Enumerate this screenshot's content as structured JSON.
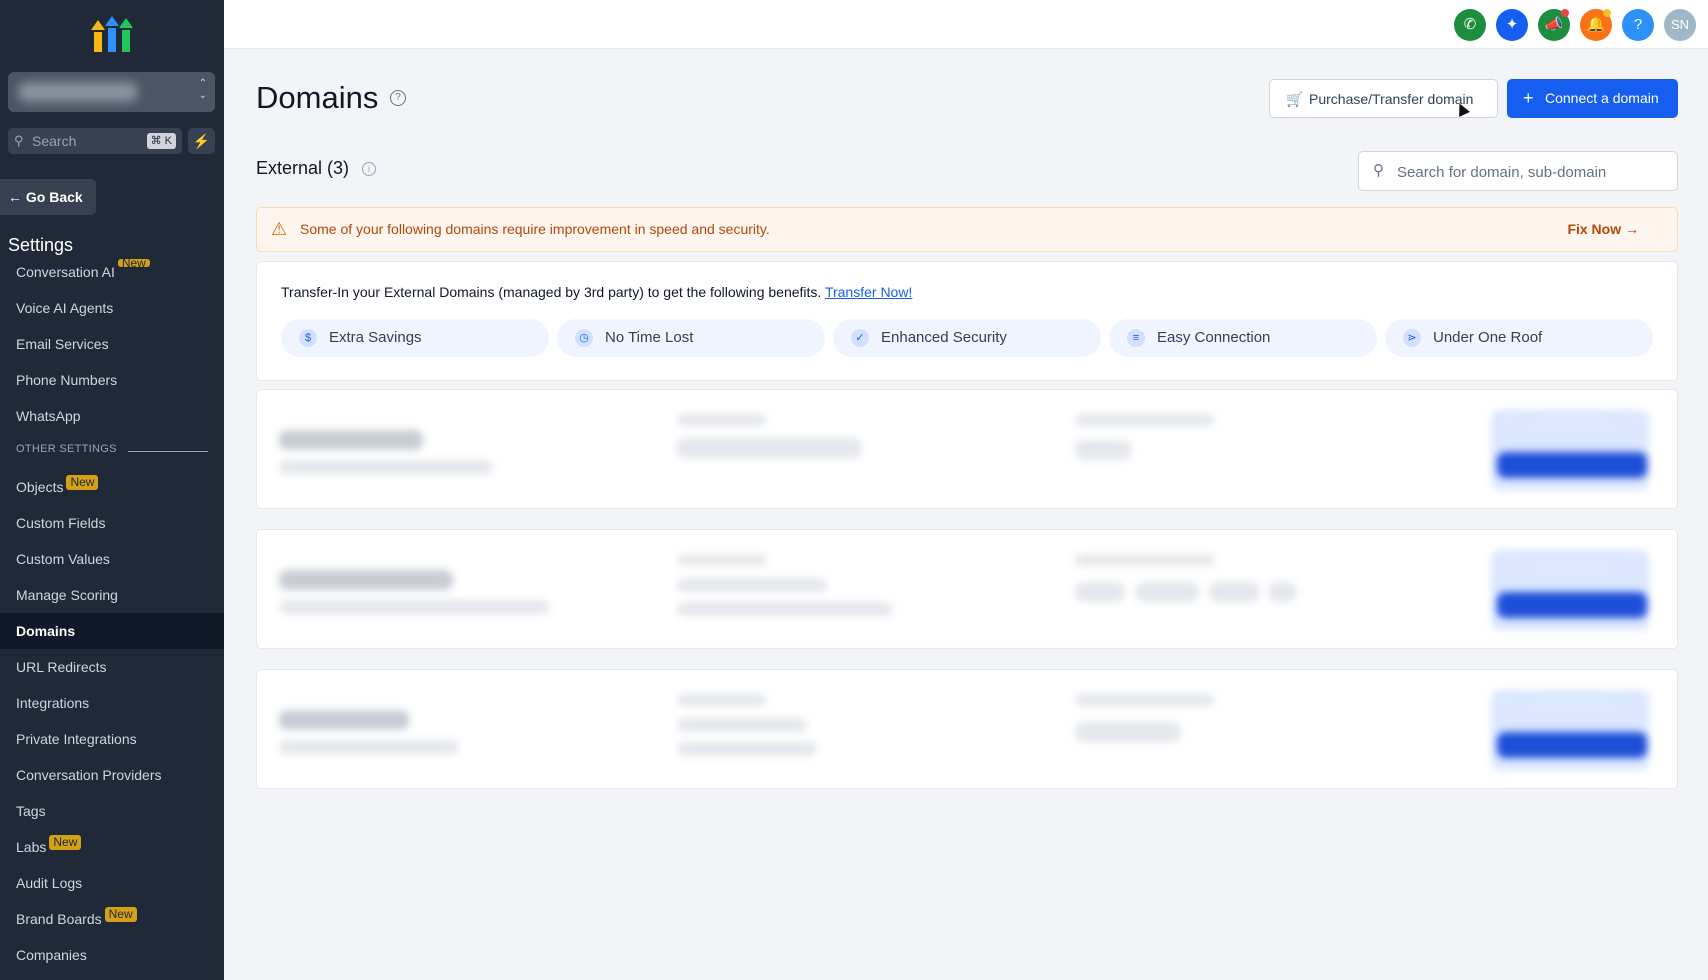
{
  "sidebar": {
    "search_placeholder": "Search",
    "search_shortcut": "⌘ K",
    "go_back": "Go Back",
    "settings_title": "Settings",
    "items_top": [
      {
        "label": "Conversation AI",
        "badge": "New"
      },
      {
        "label": "Voice AI Agents",
        "badge": ""
      },
      {
        "label": "Email Services",
        "badge": ""
      },
      {
        "label": "Phone Numbers",
        "badge": ""
      },
      {
        "label": "WhatsApp",
        "badge": ""
      }
    ],
    "other_settings_label": "OTHER SETTINGS",
    "items_other": [
      {
        "label": "Objects",
        "badge": "New"
      },
      {
        "label": "Custom Fields",
        "badge": ""
      },
      {
        "label": "Custom Values",
        "badge": ""
      },
      {
        "label": "Manage Scoring",
        "badge": ""
      },
      {
        "label": "Domains",
        "badge": "",
        "active": true
      },
      {
        "label": "URL Redirects",
        "badge": ""
      },
      {
        "label": "Integrations",
        "badge": ""
      },
      {
        "label": "Private Integrations",
        "badge": ""
      },
      {
        "label": "Conversation Providers",
        "badge": ""
      },
      {
        "label": "Tags",
        "badge": ""
      },
      {
        "label": "Labs",
        "badge": "New"
      },
      {
        "label": "Audit Logs",
        "badge": ""
      },
      {
        "label": "Brand Boards",
        "badge": "New"
      },
      {
        "label": "Companies",
        "badge": ""
      }
    ]
  },
  "topbar": {
    "avatar_initials": "SN",
    "icons": [
      "phone-icon",
      "sparkle-icon",
      "megaphone-icon",
      "bell-icon",
      "help-icon"
    ],
    "colors": {
      "phone": "#1e8e3e",
      "sparkle": "#155eef",
      "megaphone": "#1e8e3e",
      "bell": "#f97316",
      "help": "#2e90fa",
      "avatar": "#9fb8c8"
    }
  },
  "header": {
    "title": "Domains",
    "purchase_button": "Purchase/Transfer domain",
    "connect_button": "Connect a domain"
  },
  "external": {
    "title": "External (3)",
    "search_placeholder": "Search for domain, sub-domain"
  },
  "warning": {
    "text": "Some of your following domains require improvement in speed and security.",
    "action": "Fix Now"
  },
  "transfer": {
    "lead": "Transfer-In your External Domains (managed by 3rd party) to get the following benefits.",
    "link": "Transfer Now!",
    "benefits": [
      {
        "label": "Extra Savings",
        "icon": "dollar-icon"
      },
      {
        "label": "No Time Lost",
        "icon": "clock-icon"
      },
      {
        "label": "Enhanced Security",
        "icon": "shield-icon"
      },
      {
        "label": "Easy Connection",
        "icon": "sliders-icon"
      },
      {
        "label": "Under One Roof",
        "icon": "share-icon"
      }
    ]
  },
  "colors": {
    "primary": "#155eef",
    "sidebar": "#1f2937",
    "warning_text": "#b54708",
    "badge": "#d4a017"
  }
}
